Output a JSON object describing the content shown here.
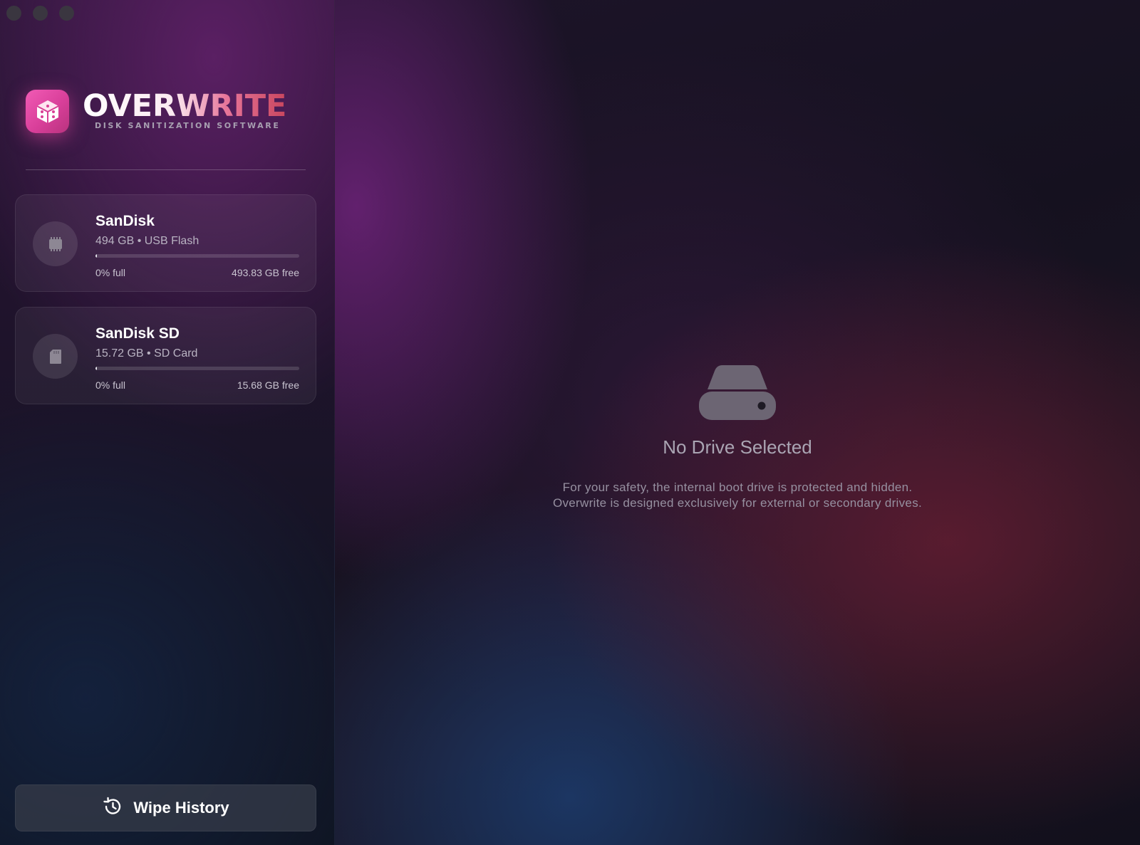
{
  "window": {
    "traffic_lights": [
      "close",
      "minimize",
      "zoom"
    ]
  },
  "brand": {
    "title": "OVERWRITE",
    "subtitle": "DISK SANITIZATION SOFTWARE",
    "icon": "cube-icon",
    "accent_color": "#e3479f"
  },
  "drives": [
    {
      "name": "SanDisk",
      "meta": "494 GB • USB Flash",
      "used_label": "0% full",
      "free_label": "493.83 GB free",
      "used_fraction": 0.0,
      "icon": "chip-icon"
    },
    {
      "name": "SanDisk SD",
      "meta": "15.72 GB • SD Card",
      "used_label": "0% full",
      "free_label": "15.68 GB free",
      "used_fraction": 0.003,
      "icon": "sd-card-icon"
    }
  ],
  "sidebar": {
    "wipe_history_label": "Wipe History",
    "wipe_history_icon": "history-icon"
  },
  "main": {
    "empty_icon": "hard-drive-icon",
    "empty_title": "No Drive Selected",
    "empty_line1": "For your safety, the internal boot drive is protected and hidden.",
    "empty_line2": "Overwrite is designed exclusively for external or secondary drives."
  }
}
